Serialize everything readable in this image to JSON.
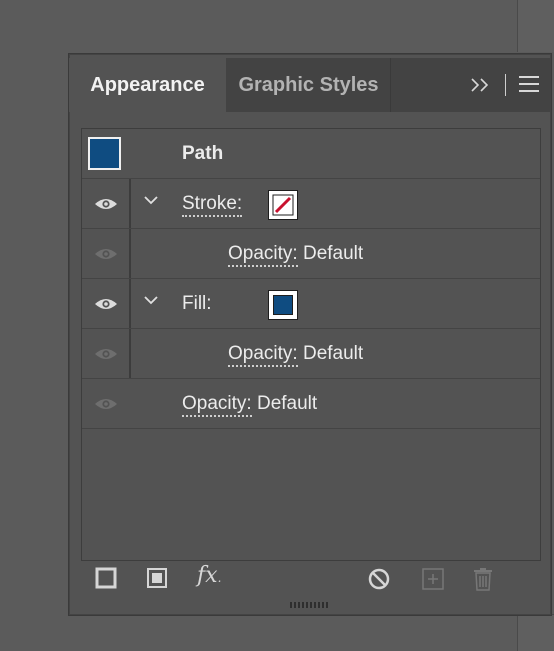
{
  "tabs": [
    {
      "label": "Appearance",
      "active": true
    },
    {
      "label": "Graphic Styles",
      "active": false
    }
  ],
  "icons": {
    "expand": "double-chevron-right-icon",
    "menu": "hamburger-menu-icon",
    "eye": "eye-icon",
    "chevron": "chevron-down-icon"
  },
  "object": {
    "label": "Path",
    "swatch_color": "#0f4c81"
  },
  "rows": {
    "stroke_label": "Stroke:",
    "stroke_opacity_label": "Opacity:",
    "stroke_opacity_value": "Default",
    "fill_label": "Fill:",
    "fill_color": "#0f4c81",
    "fill_opacity_label": "Opacity:",
    "fill_opacity_value": "Default",
    "object_opacity_label": "Opacity:",
    "object_opacity_value": "Default"
  },
  "bottom_tools": {
    "fx_label": "fx"
  },
  "colors": {
    "none_slash": "#c8102e",
    "panel_bg": "#535353"
  }
}
